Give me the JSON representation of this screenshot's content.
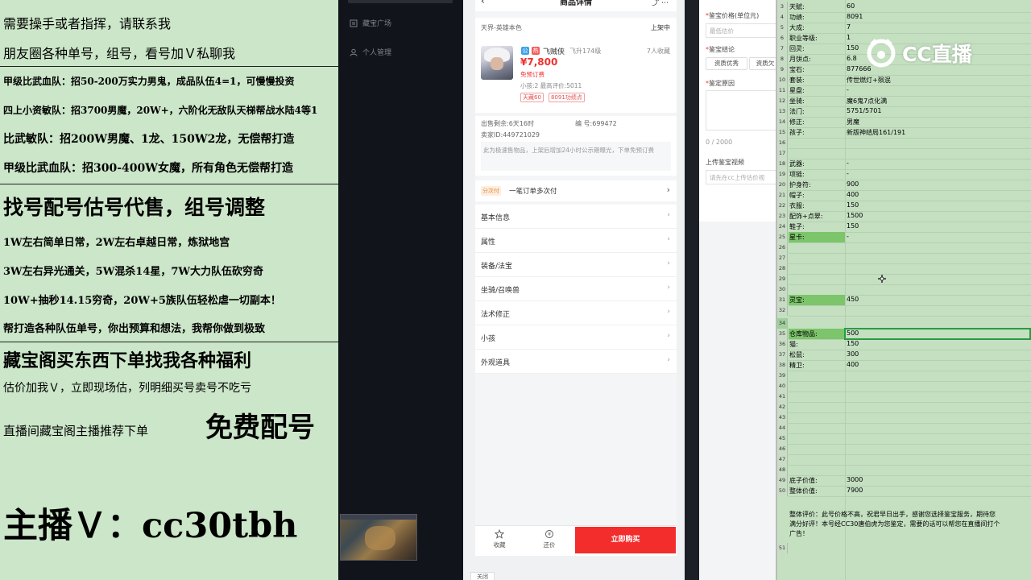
{
  "overlay": {
    "lines": [
      "需要操手或者指挥，请联系我",
      "朋友圈各种单号，组号，看号加Ｖ私聊我",
      "甲级比武血队：招50-200万实力男鬼，成品队伍4=1，可慢慢投资",
      "四上小资敏队：招3700男魔，20W+，六阶化无敌队天梯帮战水陆4等1",
      "比武敏队：招200W男魔、1龙、150W2龙，无偿帮打造",
      "甲级比武血队：招300-400W女魔，所有角色无偿帮打造",
      "找号配号估号代售，组号调整",
      "1W左右简单日常，2W左右卓越日常，炼狱地宫",
      "3W左右异光通关，5W混杀14星，7W大力队伍砍穷奇",
      "10W+抽秒14.15穷奇，20W+5族队伍轻松虐一切副本！",
      "帮打造各种队伍单号，你出预算和想法，我帮你做到极致",
      "藏宝阁买东西下单找我各种福利",
      "估价加我Ｖ，立即现场估，列明细买号卖号不吃亏",
      "直播间藏宝阁主播推荐下单",
      "免费配号",
      "主播Ｖ：cc30tbh"
    ]
  },
  "sidebar": {
    "items": [
      {
        "icon": "bookmark-icon",
        "label": "藏宝广场"
      },
      {
        "icon": "person-icon",
        "label": "个人管理"
      }
    ]
  },
  "phone": {
    "header": {
      "title": "商品详情"
    },
    "server_label": "天界-英雄本色",
    "status": "上架中",
    "item": {
      "name": "飞贼侠",
      "level": "飞升174级",
      "favorites": "7人收藏",
      "price": "¥7,800",
      "price_note": "免预订费",
      "kids_line": "小孩:2 最高评价:5011",
      "tags": [
        "天藏60",
        "8091功绩点"
      ]
    },
    "meta": {
      "remaining": "出售剩余:6天16时",
      "number": "编 号:699472",
      "seller": "卖家ID:449721029"
    },
    "notice": "此为极速售物品，上架后增加24小时公示期曝光，下单免预订费",
    "installment": {
      "tag": "分次付",
      "label": "一笔订单多次付"
    },
    "menu": [
      "基本信息",
      "属性",
      "装备/法宝",
      "坐骑/召唤兽",
      "法术修正",
      "小孩",
      "外观道具"
    ],
    "bottom": {
      "favorite": "收藏",
      "bargain": "还价",
      "buy": "立即购买"
    },
    "close_chip": "关闭"
  },
  "form": {
    "price_label": "鉴宝价格(单位元)",
    "price_placeholder": "最低估价",
    "result_label": "鉴宝结论",
    "result_options": [
      "资质优秀",
      "资质欠"
    ],
    "reason_label": "鉴定原因",
    "counter": "0 / 2000",
    "video_label": "上传鉴宝视频",
    "video_placeholder": "请先在cc上传估价视"
  },
  "sheet": {
    "rows": [
      {
        "n": "3",
        "a": "天赋:",
        "b": "60"
      },
      {
        "n": "4",
        "a": "功绩:",
        "b": "8091"
      },
      {
        "n": "5",
        "a": "大成:",
        "b": "7"
      },
      {
        "n": "6",
        "a": "职业等级:",
        "b": "1"
      },
      {
        "n": "7",
        "a": "回灵:",
        "b": "150"
      },
      {
        "n": "8",
        "a": "月饼点:",
        "b": "6.8"
      },
      {
        "n": "9",
        "a": "宝石:",
        "b": "877666"
      },
      {
        "n": "10",
        "a": "套装:",
        "b": "传世燃灯+殒泯"
      },
      {
        "n": "11",
        "a": "星盘:",
        "b": "-"
      },
      {
        "n": "12",
        "a": "坐骑:",
        "b": "魔6鬼7点化满"
      },
      {
        "n": "13",
        "a": "法门:",
        "b": "5751/5701"
      },
      {
        "n": "14",
        "a": "修正:",
        "b": "男魔"
      },
      {
        "n": "15",
        "a": "孩子:",
        "b": "新版神结局161/191"
      },
      {
        "n": "16",
        "a": "",
        "b": ""
      },
      {
        "n": "17",
        "a": "",
        "b": ""
      },
      {
        "n": "18",
        "a": "武器:",
        "b": "-"
      },
      {
        "n": "19",
        "a": "项链:",
        "b": "-"
      },
      {
        "n": "20",
        "a": "护身符:",
        "b": "900"
      },
      {
        "n": "21",
        "a": "帽子:",
        "b": "400"
      },
      {
        "n": "22",
        "a": "衣服:",
        "b": "150"
      },
      {
        "n": "23",
        "a": "配饰+点翠:",
        "b": "1500"
      },
      {
        "n": "24",
        "a": "鞋子:",
        "b": "150"
      },
      {
        "n": "25",
        "a": "星卡:",
        "b": "-"
      },
      {
        "n": "26",
        "a": "",
        "b": ""
      },
      {
        "n": "27",
        "a": "",
        "b": ""
      },
      {
        "n": "28",
        "a": "",
        "b": ""
      },
      {
        "n": "29",
        "a": "",
        "b": ""
      },
      {
        "n": "30",
        "a": "",
        "b": ""
      },
      {
        "n": "31",
        "a": "灵宝:",
        "b": "450"
      },
      {
        "n": "32",
        "a": "",
        "b": ""
      },
      {
        "n": "34",
        "a": "",
        "b": ""
      },
      {
        "n": "35",
        "a": "仓库物品:",
        "b": "500"
      },
      {
        "n": "36",
        "a": "猫:",
        "b": "150"
      },
      {
        "n": "37",
        "a": "松鼠:",
        "b": "300"
      },
      {
        "n": "38",
        "a": "精卫:",
        "b": "400"
      },
      {
        "n": "39",
        "a": "",
        "b": ""
      },
      {
        "n": "40",
        "a": "",
        "b": ""
      },
      {
        "n": "41",
        "a": "",
        "b": ""
      },
      {
        "n": "42",
        "a": "",
        "b": ""
      },
      {
        "n": "43",
        "a": "",
        "b": ""
      },
      {
        "n": "44",
        "a": "",
        "b": ""
      },
      {
        "n": "45",
        "a": "",
        "b": ""
      },
      {
        "n": "46",
        "a": "",
        "b": ""
      },
      {
        "n": "47",
        "a": "",
        "b": ""
      },
      {
        "n": "48",
        "a": "",
        "b": ""
      },
      {
        "n": "49",
        "a": "底子价值:",
        "b": "3000"
      },
      {
        "n": "50",
        "a": "整体价值:",
        "b": "7900"
      }
    ],
    "highlighted": [
      "25",
      "31",
      "35"
    ],
    "comment_lines": [
      "整体评价：此号价格不高，祝君早日出手，感谢您选择鉴宝服务，期待您",
      "满分好评！本号经CC30唐伯虎为您鉴定，需要的话可以帮您在直播间打个",
      "广告！"
    ],
    "last_row": "51"
  },
  "watermark": {
    "text": "CC直播"
  }
}
